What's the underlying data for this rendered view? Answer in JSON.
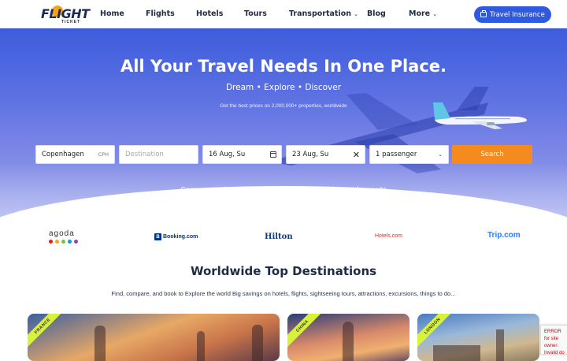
{
  "brand": {
    "logo_text": "FLIGHT",
    "logo_sub": "TICKET"
  },
  "nav": {
    "items": [
      "Home",
      "Flights",
      "Hotels",
      "Tours",
      "Transportation",
      "Blog",
      "More"
    ],
    "insurance_label": "Travel Insurance"
  },
  "hero": {
    "title": "All Your Travel Needs In One Place.",
    "subtitle": "Dream • Explore • Discover",
    "tagline": "Get the best prices on 2,000,000+ properties, worldwide",
    "compare": "Compare prices from leading airlines and travel agents"
  },
  "search": {
    "origin_value": "Copenhagen",
    "origin_code": "CPH",
    "destination_placeholder": "Destination",
    "depart_value": "16 Aug, Su",
    "return_value": "23 Aug, Su",
    "passengers_value": "1 passenger",
    "button_label": "Search"
  },
  "partners": {
    "agoda": "agoda",
    "booking": "Booking.com",
    "booking_mark": "B",
    "hilton": "Hilton",
    "hotels": "Hotels.com",
    "trip": "Trip.com",
    "agoda_colors": [
      "#e2231a",
      "#f5a623",
      "#7ac143",
      "#00a0e0",
      "#8e44ad"
    ]
  },
  "destinations": {
    "title": "Worldwide Top Destinations",
    "subtitle": "Find, compare, and book to Explore the world Big savings on hotels, flights, sightseeing tours, attractions, excursions, things to do...",
    "cards": [
      {
        "tag": "FRANCE"
      },
      {
        "tag": "CHINA"
      },
      {
        "tag": "LONDON"
      }
    ]
  },
  "recaptcha": {
    "text": "ERROR for site owner: Invalid do"
  },
  "colors": {
    "primary": "#2f5ae0",
    "search": "#f58a1f",
    "ribbon": "#d8f23a"
  }
}
